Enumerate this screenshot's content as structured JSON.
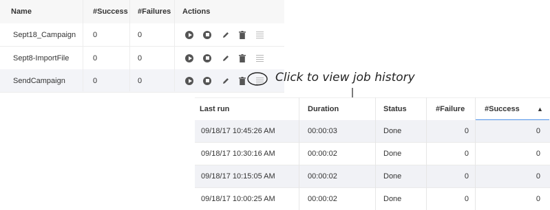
{
  "jobs_table": {
    "headers": [
      "Name",
      "#Success",
      "#Failures",
      "Actions"
    ],
    "rows": [
      {
        "name": "Sept18_Campaign",
        "success": "0",
        "failures": "0"
      },
      {
        "name": "Sept8-ImportFile",
        "success": "0",
        "failures": "0"
      },
      {
        "name": "SendCampaign",
        "success": "0",
        "failures": "0"
      }
    ],
    "action_icons": [
      "play-icon",
      "stop-icon",
      "pencil-icon",
      "trash-icon",
      "history-list-icon"
    ]
  },
  "annotation": {
    "text": "Click to view job history"
  },
  "history_table": {
    "headers": [
      "Last run",
      "Duration",
      "Status",
      "#Failure",
      "#Success"
    ],
    "sort_indicator": "▲",
    "rows": [
      {
        "last_run": "09/18/17 10:45:26 AM",
        "duration": "00:00:03",
        "status": "Done",
        "failure": "0",
        "success": "0"
      },
      {
        "last_run": "09/18/17 10:30:16 AM",
        "duration": "00:00:02",
        "status": "Done",
        "failure": "0",
        "success": "0"
      },
      {
        "last_run": "09/18/17 10:15:05 AM",
        "duration": "00:00:02",
        "status": "Done",
        "failure": "0",
        "success": "0"
      },
      {
        "last_run": "09/18/17 10:00:25 AM",
        "duration": "00:00:02",
        "status": "Done",
        "failure": "0",
        "success": "0"
      }
    ]
  },
  "colors": {
    "sort_accent": "#4a8fe7",
    "row_stripe": "#f1f2f6",
    "header_bg": "#f7f7f7"
  }
}
